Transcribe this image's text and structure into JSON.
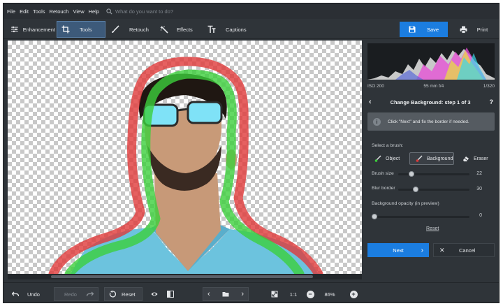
{
  "menu": {
    "items": [
      "File",
      "Edit",
      "Tools",
      "Retouch",
      "View",
      "Help"
    ],
    "search_placeholder": "What do you want to do?"
  },
  "toolbar": {
    "tabs": [
      {
        "label": "Enhancement",
        "icon": "sliders-icon"
      },
      {
        "label": "Tools",
        "icon": "crop-icon",
        "active": true
      },
      {
        "label": "Retouch",
        "icon": "brush-icon"
      },
      {
        "label": "Effects",
        "icon": "magic-wand-icon"
      },
      {
        "label": "Captions",
        "icon": "text-icon"
      }
    ],
    "save_label": "Save",
    "print_label": "Print"
  },
  "photo_info": {
    "iso": "ISO 200",
    "lens": "55 mm f/4",
    "shutter": "1/320"
  },
  "panel": {
    "step_title": "Change Background: step 1 of 3",
    "help": "?",
    "info_text": "Click \"Next\" and fix the border if needed.",
    "brush_label": "Select a brush:",
    "brushes": [
      {
        "label": "Object"
      },
      {
        "label": "Background",
        "active": true
      },
      {
        "label": "Eraser"
      }
    ],
    "brush_size": {
      "label": "Brush size",
      "value": "22",
      "fraction": 0.16
    },
    "blur_border": {
      "label": "Blur border",
      "value": "30",
      "fraction": 0.22
    },
    "bg_opacity": {
      "label": "Background opacity (in preview)",
      "value": "0",
      "fraction": 0.0
    },
    "reset_label": "Reset",
    "next_label": "Next",
    "cancel_label": "Cancel"
  },
  "bottom": {
    "undo": "Undo",
    "redo": "Redo",
    "reset": "Reset",
    "fit": "1:1",
    "zoom": "86%"
  },
  "colors": {
    "accent": "#1b7de0",
    "object_stroke": "#3ccf3c",
    "background_stroke": "#e03a3a"
  }
}
